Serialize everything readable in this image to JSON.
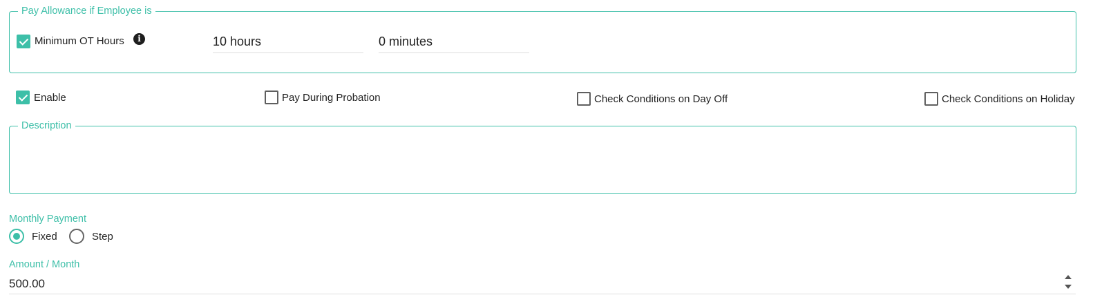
{
  "pay_allowance": {
    "legend": "Pay Allowance if Employee is",
    "min_ot": {
      "label": "Minimum OT Hours",
      "checked": true,
      "hours": "10 hours",
      "minutes": "0 minutes",
      "info_icon": "info-icon"
    }
  },
  "options": {
    "enable": {
      "label": "Enable",
      "checked": true
    },
    "pay_during_probation": {
      "label": "Pay During Probation",
      "checked": false
    },
    "check_day_off": {
      "label": "Check Conditions on Day Off",
      "checked": false
    },
    "check_holiday": {
      "label": "Check Conditions on Holiday",
      "checked": false
    }
  },
  "description": {
    "legend": "Description",
    "value": ""
  },
  "monthly_payment": {
    "label": "Monthly Payment",
    "options": [
      {
        "label": "Fixed",
        "selected": true
      },
      {
        "label": "Step",
        "selected": false
      }
    ]
  },
  "amount": {
    "label": "Amount / Month",
    "value": "500.00"
  },
  "colors": {
    "accent": "#3dbfa8",
    "checkbox_border": "#5f5f5f"
  }
}
